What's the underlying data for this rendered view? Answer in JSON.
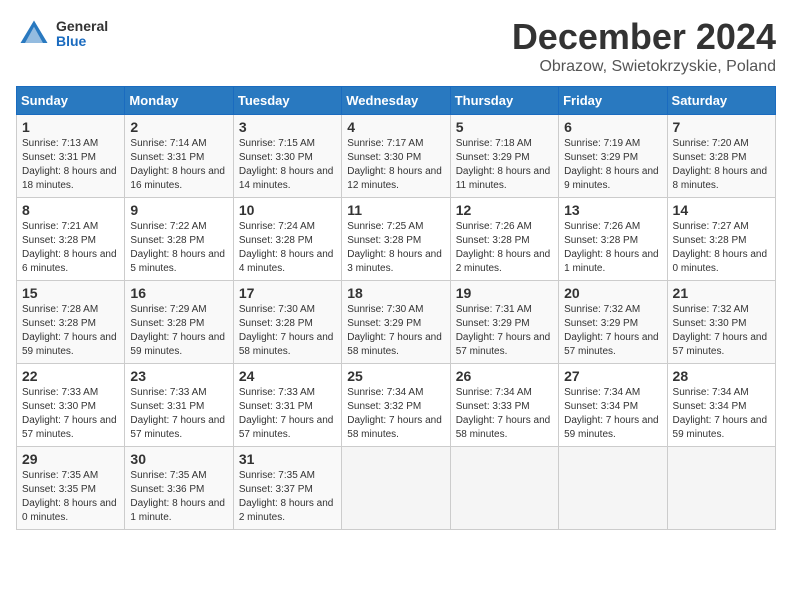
{
  "header": {
    "logo_general": "General",
    "logo_blue": "Blue",
    "month_title": "December 2024",
    "location": "Obrazow, Swietokrzyskie, Poland"
  },
  "days_of_week": [
    "Sunday",
    "Monday",
    "Tuesday",
    "Wednesday",
    "Thursday",
    "Friday",
    "Saturday"
  ],
  "weeks": [
    [
      {
        "day": "1",
        "info": "Sunrise: 7:13 AM\nSunset: 3:31 PM\nDaylight: 8 hours and 18 minutes."
      },
      {
        "day": "2",
        "info": "Sunrise: 7:14 AM\nSunset: 3:31 PM\nDaylight: 8 hours and 16 minutes."
      },
      {
        "day": "3",
        "info": "Sunrise: 7:15 AM\nSunset: 3:30 PM\nDaylight: 8 hours and 14 minutes."
      },
      {
        "day": "4",
        "info": "Sunrise: 7:17 AM\nSunset: 3:30 PM\nDaylight: 8 hours and 12 minutes."
      },
      {
        "day": "5",
        "info": "Sunrise: 7:18 AM\nSunset: 3:29 PM\nDaylight: 8 hours and 11 minutes."
      },
      {
        "day": "6",
        "info": "Sunrise: 7:19 AM\nSunset: 3:29 PM\nDaylight: 8 hours and 9 minutes."
      },
      {
        "day": "7",
        "info": "Sunrise: 7:20 AM\nSunset: 3:28 PM\nDaylight: 8 hours and 8 minutes."
      }
    ],
    [
      {
        "day": "8",
        "info": "Sunrise: 7:21 AM\nSunset: 3:28 PM\nDaylight: 8 hours and 6 minutes."
      },
      {
        "day": "9",
        "info": "Sunrise: 7:22 AM\nSunset: 3:28 PM\nDaylight: 8 hours and 5 minutes."
      },
      {
        "day": "10",
        "info": "Sunrise: 7:24 AM\nSunset: 3:28 PM\nDaylight: 8 hours and 4 minutes."
      },
      {
        "day": "11",
        "info": "Sunrise: 7:25 AM\nSunset: 3:28 PM\nDaylight: 8 hours and 3 minutes."
      },
      {
        "day": "12",
        "info": "Sunrise: 7:26 AM\nSunset: 3:28 PM\nDaylight: 8 hours and 2 minutes."
      },
      {
        "day": "13",
        "info": "Sunrise: 7:26 AM\nSunset: 3:28 PM\nDaylight: 8 hours and 1 minute."
      },
      {
        "day": "14",
        "info": "Sunrise: 7:27 AM\nSunset: 3:28 PM\nDaylight: 8 hours and 0 minutes."
      }
    ],
    [
      {
        "day": "15",
        "info": "Sunrise: 7:28 AM\nSunset: 3:28 PM\nDaylight: 7 hours and 59 minutes."
      },
      {
        "day": "16",
        "info": "Sunrise: 7:29 AM\nSunset: 3:28 PM\nDaylight: 7 hours and 59 minutes."
      },
      {
        "day": "17",
        "info": "Sunrise: 7:30 AM\nSunset: 3:28 PM\nDaylight: 7 hours and 58 minutes."
      },
      {
        "day": "18",
        "info": "Sunrise: 7:30 AM\nSunset: 3:29 PM\nDaylight: 7 hours and 58 minutes."
      },
      {
        "day": "19",
        "info": "Sunrise: 7:31 AM\nSunset: 3:29 PM\nDaylight: 7 hours and 57 minutes."
      },
      {
        "day": "20",
        "info": "Sunrise: 7:32 AM\nSunset: 3:29 PM\nDaylight: 7 hours and 57 minutes."
      },
      {
        "day": "21",
        "info": "Sunrise: 7:32 AM\nSunset: 3:30 PM\nDaylight: 7 hours and 57 minutes."
      }
    ],
    [
      {
        "day": "22",
        "info": "Sunrise: 7:33 AM\nSunset: 3:30 PM\nDaylight: 7 hours and 57 minutes."
      },
      {
        "day": "23",
        "info": "Sunrise: 7:33 AM\nSunset: 3:31 PM\nDaylight: 7 hours and 57 minutes."
      },
      {
        "day": "24",
        "info": "Sunrise: 7:33 AM\nSunset: 3:31 PM\nDaylight: 7 hours and 57 minutes."
      },
      {
        "day": "25",
        "info": "Sunrise: 7:34 AM\nSunset: 3:32 PM\nDaylight: 7 hours and 58 minutes."
      },
      {
        "day": "26",
        "info": "Sunrise: 7:34 AM\nSunset: 3:33 PM\nDaylight: 7 hours and 58 minutes."
      },
      {
        "day": "27",
        "info": "Sunrise: 7:34 AM\nSunset: 3:34 PM\nDaylight: 7 hours and 59 minutes."
      },
      {
        "day": "28",
        "info": "Sunrise: 7:34 AM\nSunset: 3:34 PM\nDaylight: 7 hours and 59 minutes."
      }
    ],
    [
      {
        "day": "29",
        "info": "Sunrise: 7:35 AM\nSunset: 3:35 PM\nDaylight: 8 hours and 0 minutes."
      },
      {
        "day": "30",
        "info": "Sunrise: 7:35 AM\nSunset: 3:36 PM\nDaylight: 8 hours and 1 minute."
      },
      {
        "day": "31",
        "info": "Sunrise: 7:35 AM\nSunset: 3:37 PM\nDaylight: 8 hours and 2 minutes."
      },
      null,
      null,
      null,
      null
    ]
  ]
}
